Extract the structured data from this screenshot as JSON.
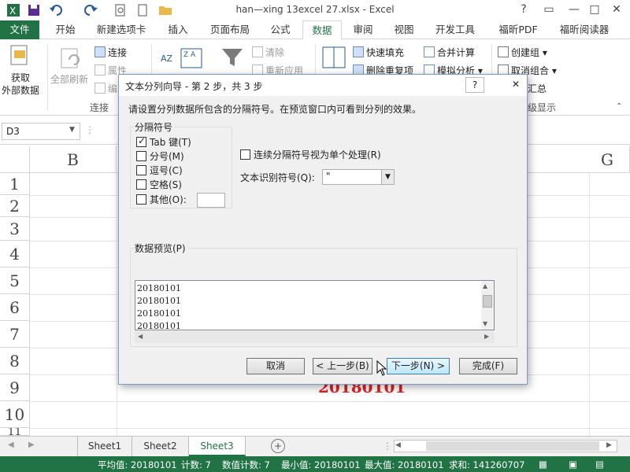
{
  "window": {
    "title": "han—xing 13excel 27.xlsx - Excel",
    "controls": [
      "?",
      "▭",
      "—",
      "□",
      "✕"
    ]
  },
  "tabs": [
    "文件",
    "开始",
    "新建选项卡",
    "插入",
    "页面布局",
    "公式",
    "数据",
    "审阅",
    "视图",
    "开发工具",
    "福昕PDF",
    "福昕阅读器"
  ],
  "ribbon": {
    "get_external": "获取",
    "get_external2": "外部数据",
    "refresh_all": "全部刷新",
    "connections": "连接",
    "properties": "属性",
    "edit_links": "编",
    "group_connections": "连接",
    "clear": "清除",
    "reapply": "重新应用",
    "flash_fill": "快速填充",
    "remove_dup": "删除重复项",
    "consolidate": "合并计算",
    "what_if": "模拟分析",
    "group": "创建组",
    "ungroup": "取消组合",
    "subtotal": "汇总",
    "group_outline": "级显示"
  },
  "formula_bar": {
    "name_box": "D3"
  },
  "grid": {
    "col_b": "B",
    "col_g": "G",
    "rows": [
      "1",
      "2",
      "3",
      "4",
      "5",
      "6",
      "7",
      "8",
      "9",
      "10",
      "11"
    ],
    "cell_value": "20180101"
  },
  "dialog": {
    "title": "文本分列向导 - 第 2 步，共 3 步",
    "help": "?",
    "close": "✕",
    "instruction": "请设置分列数据所包含的分隔符号。在预览窗口内可看到分列的效果。",
    "delimiters_legend": "分隔符号",
    "tab_label": "Tab 键(T)",
    "semicolon_label": "分号(M)",
    "comma_label": "逗号(C)",
    "space_label": "空格(S)",
    "other_label": "其他(O):",
    "consecutive_label": "连续分隔符号视为单个处理(R)",
    "qualifier_label": "文本识别符号(Q):",
    "qualifier_value": "\"",
    "preview_legend": "数据预览(P)",
    "preview_rows": [
      "20180101",
      "20180101",
      "20180101",
      "20180101"
    ],
    "cancel": "取消",
    "back": "< 上一步(B)",
    "next": "下一步(N) >",
    "finish": "完成(F)"
  },
  "sheets": [
    "Sheet1",
    "Sheet2",
    "Sheet3"
  ],
  "status": {
    "average": "平均值: 20180101",
    "count": "计数: 7",
    "numeric_count": "数值计数: 7",
    "min": "最小值: 20180101",
    "max": "最大值: 20180101",
    "sum": "求和: 141260707"
  },
  "colors": {
    "excel_green": "#217346",
    "red_value": "#e02020"
  }
}
